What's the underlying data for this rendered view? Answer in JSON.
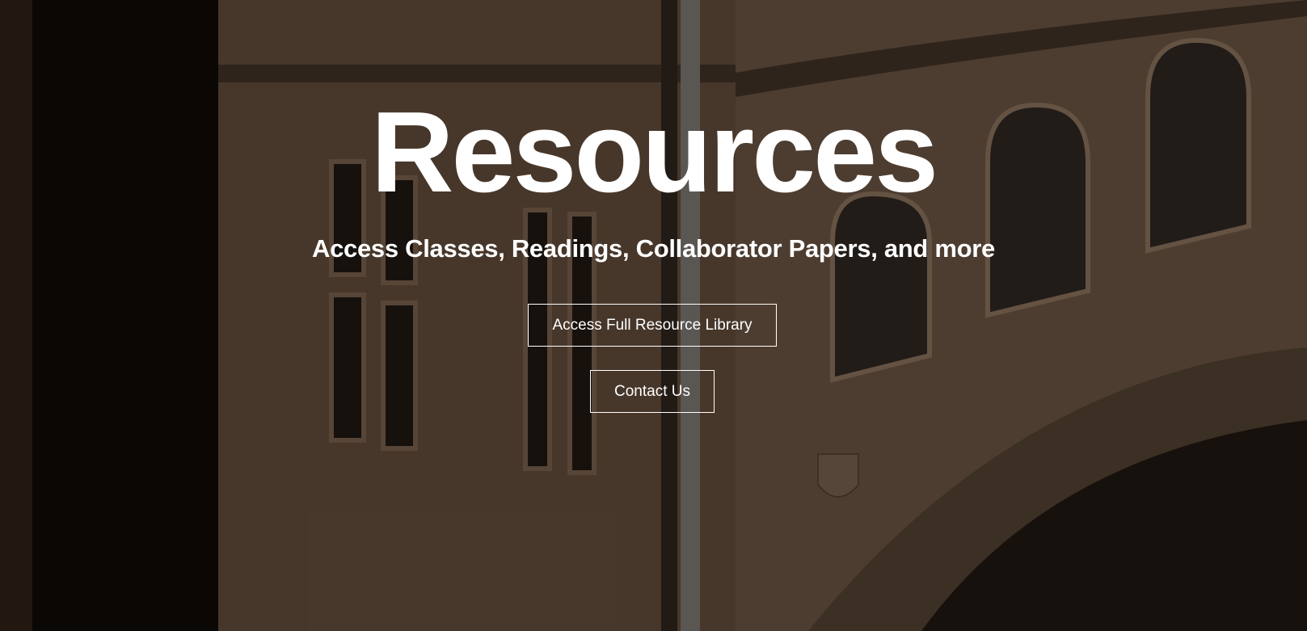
{
  "hero": {
    "title": "Resources",
    "subtitle": "Access Classes, Readings, Collaborator Papers, and more",
    "primary_button_label": "Access Full Resource Library",
    "secondary_button_label": "Contact Us"
  },
  "colors": {
    "text": "#ffffff",
    "button_border": "#ffffff"
  }
}
